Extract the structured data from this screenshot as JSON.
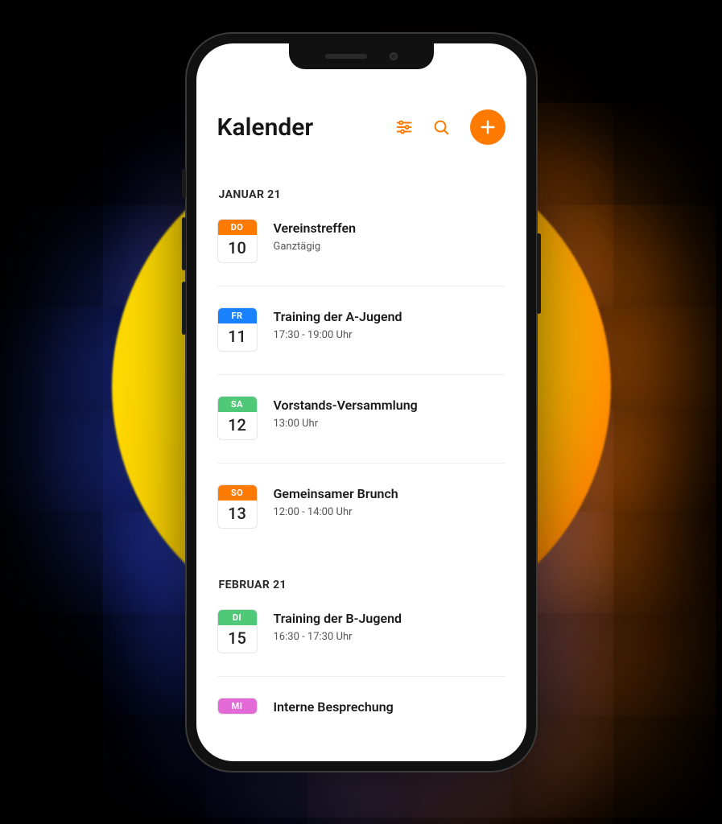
{
  "header": {
    "title": "Kalender"
  },
  "colors": {
    "accent": "#ff7a00",
    "blue": "#1a82ff",
    "green": "#4fc978",
    "pink": "#e36ad6"
  },
  "sections": [
    {
      "label": "JANUAR 21",
      "events": [
        {
          "dow": "DO",
          "day": "10",
          "color": "orange",
          "title": "Vereinstreffen",
          "time": "Ganztägig"
        },
        {
          "dow": "FR",
          "day": "11",
          "color": "blue",
          "title": "Training der A-Jugend",
          "time": "17:30 - 19:00 Uhr"
        },
        {
          "dow": "SA",
          "day": "12",
          "color": "green",
          "title": "Vorstands-Versammlung",
          "time": "13:00  Uhr"
        },
        {
          "dow": "SO",
          "day": "13",
          "color": "orange",
          "title": "Gemeinsamer Brunch",
          "time": "12:00 - 14:00 Uhr"
        }
      ]
    },
    {
      "label": "FEBRUAR 21",
      "events": [
        {
          "dow": "DI",
          "day": "15",
          "color": "green",
          "title": "Training der B-Jugend",
          "time": "16:30 - 17:30 Uhr"
        },
        {
          "dow": "MI",
          "day": "",
          "color": "pink",
          "title": "Interne Besprechung",
          "time": ""
        }
      ]
    }
  ]
}
